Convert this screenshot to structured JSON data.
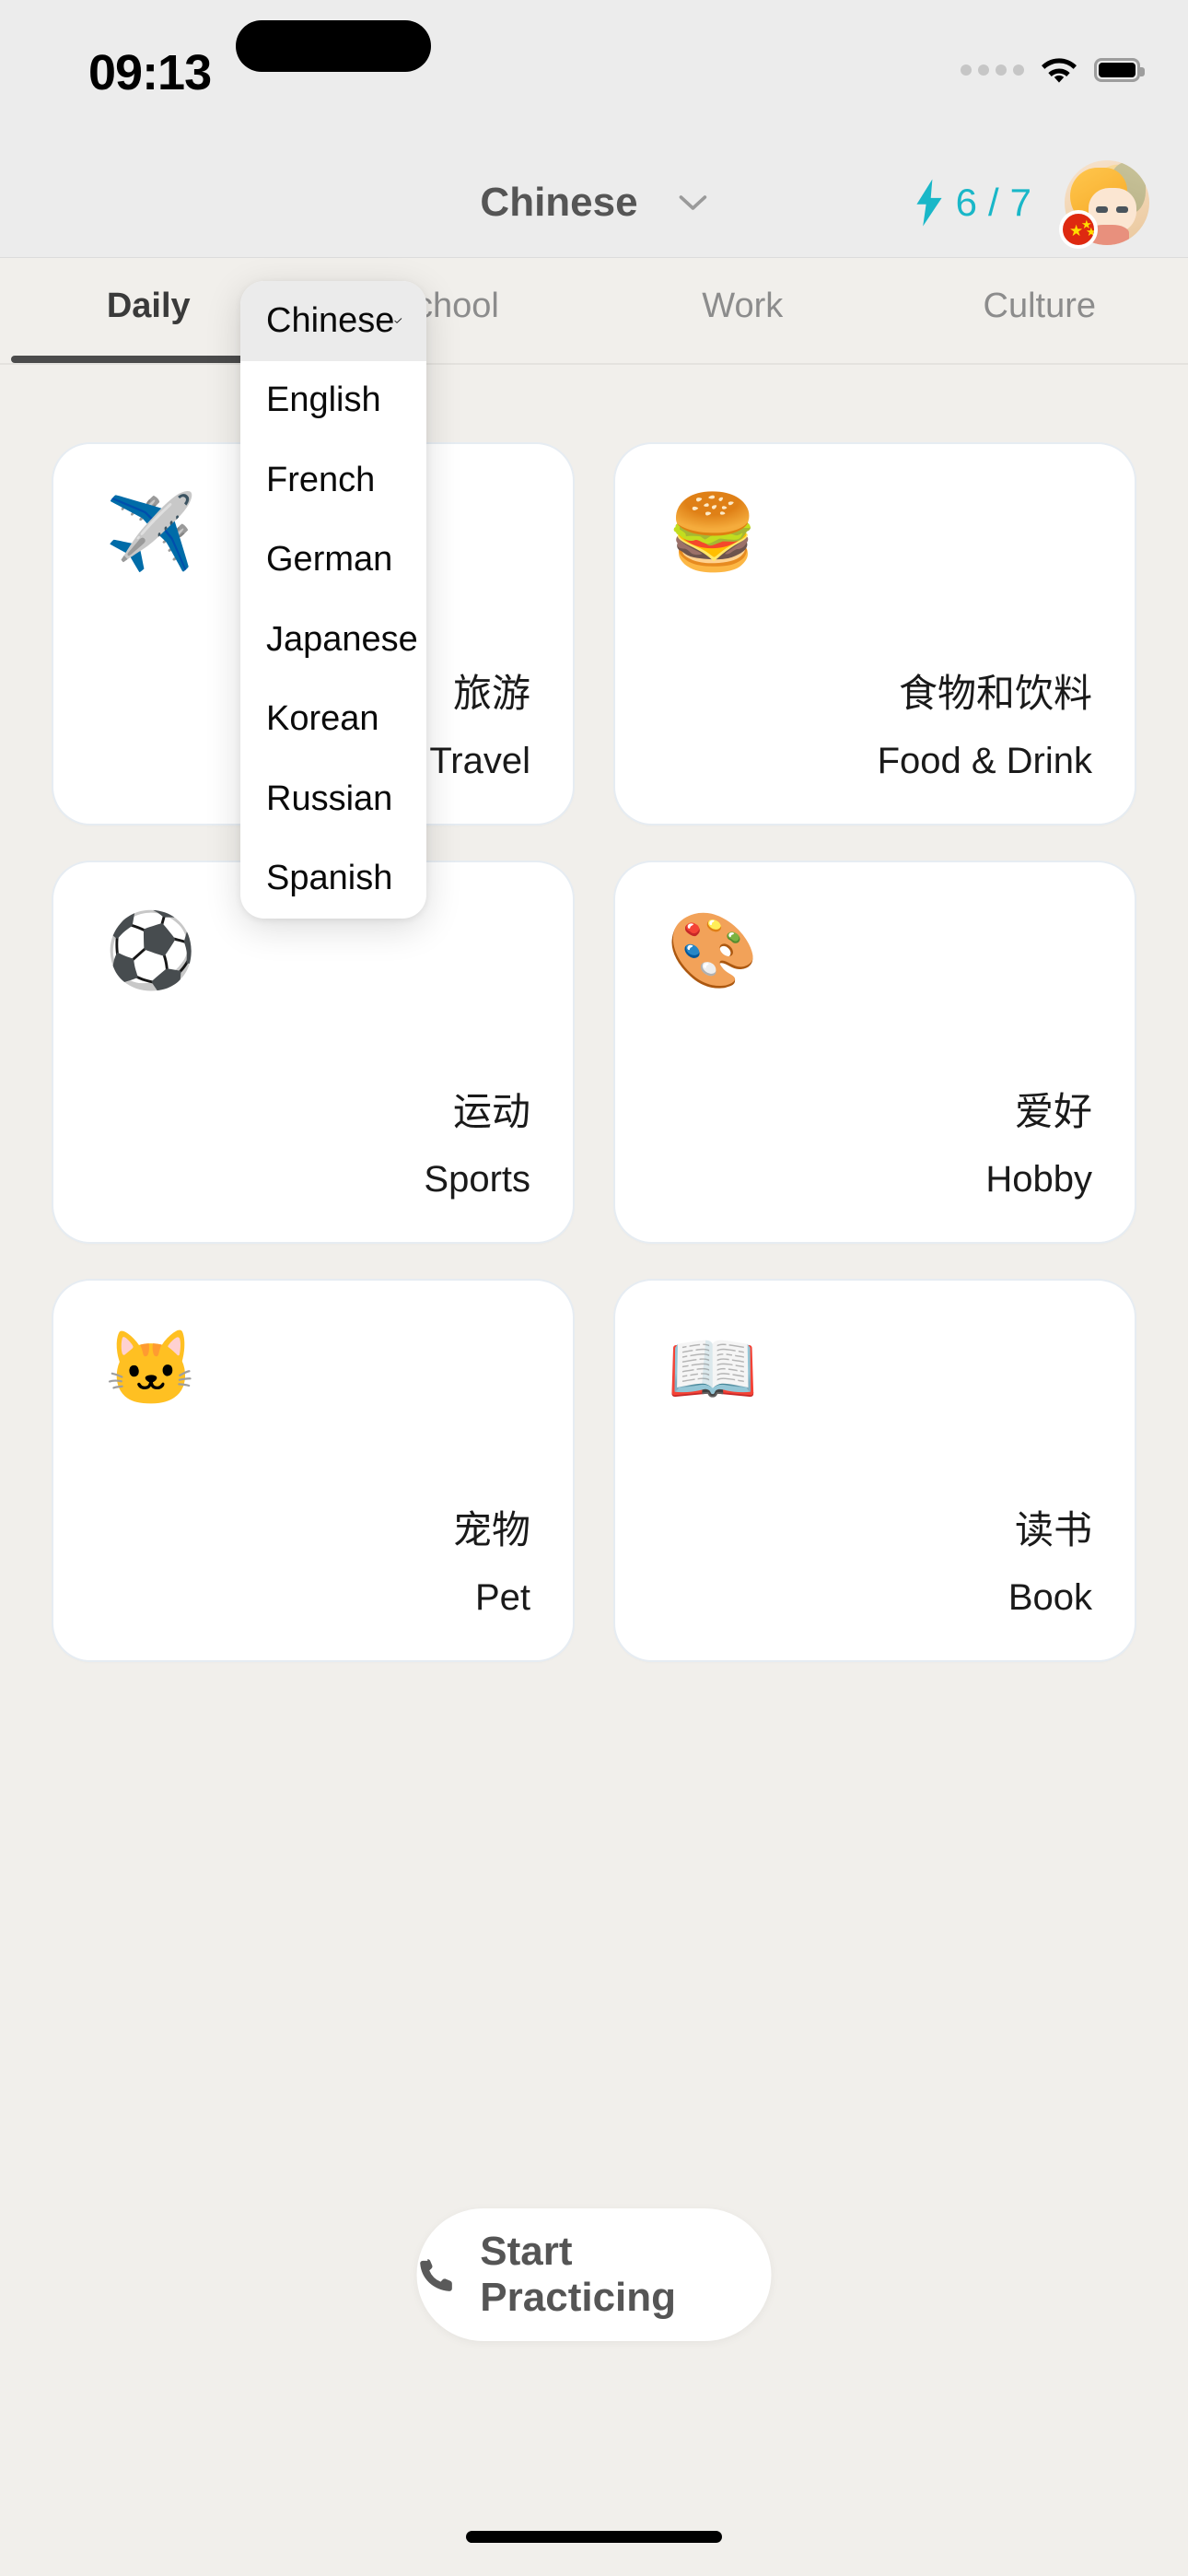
{
  "status_bar": {
    "time": "09:13",
    "signal_icon": "signal-dots-icon",
    "wifi_icon": "wifi-icon",
    "battery_icon": "battery-icon"
  },
  "navbar": {
    "selected_language": "Chinese",
    "chevron_icon": "chevron-down-icon",
    "streak": {
      "bolt_icon": "lightning-bolt-icon",
      "current": "6",
      "separator": "/",
      "total": "7",
      "color": "#19b7c8"
    },
    "avatar": {
      "name": "avatar",
      "flag_badge": "china-flag-badge"
    }
  },
  "tabs": [
    {
      "label": "Daily",
      "active": true
    },
    {
      "label": "School",
      "active": false
    },
    {
      "label": "Work",
      "active": false
    },
    {
      "label": "Culture",
      "active": false
    }
  ],
  "language_dropdown": {
    "open": true,
    "check_icon": "check-icon",
    "items": [
      {
        "label": "Chinese",
        "selected": true
      },
      {
        "label": "English",
        "selected": false
      },
      {
        "label": "French",
        "selected": false
      },
      {
        "label": "German",
        "selected": false
      },
      {
        "label": "Japanese",
        "selected": false
      },
      {
        "label": "Korean",
        "selected": false
      },
      {
        "label": "Russian",
        "selected": false
      },
      {
        "label": "Spanish",
        "selected": false
      }
    ]
  },
  "categories": [
    {
      "emoji": "✈️",
      "icon_name": "airplane-icon",
      "native": "旅游",
      "latin": "Travel"
    },
    {
      "emoji": "🍔",
      "icon_name": "hamburger-icon",
      "native": "食物和饮料",
      "latin": "Food & Drink"
    },
    {
      "emoji": "⚽",
      "icon_name": "soccer-ball-icon",
      "native": "运动",
      "latin": "Sports"
    },
    {
      "emoji": "🎨",
      "icon_name": "artist-palette-icon",
      "native": "爱好",
      "latin": "Hobby"
    },
    {
      "emoji": "🐱",
      "icon_name": "cat-face-icon",
      "native": "宠物",
      "latin": "Pet"
    },
    {
      "emoji": "📖",
      "icon_name": "open-book-icon",
      "native": "读书",
      "latin": "Book"
    }
  ],
  "cta": {
    "icon": "phone-icon",
    "label": "Start Practicing"
  },
  "colors": {
    "background": "#f1efeb",
    "card": "#ffffff",
    "accent": "#19b7c8",
    "text_primary": "#1a1a1a",
    "text_muted": "#8c8c8c"
  }
}
